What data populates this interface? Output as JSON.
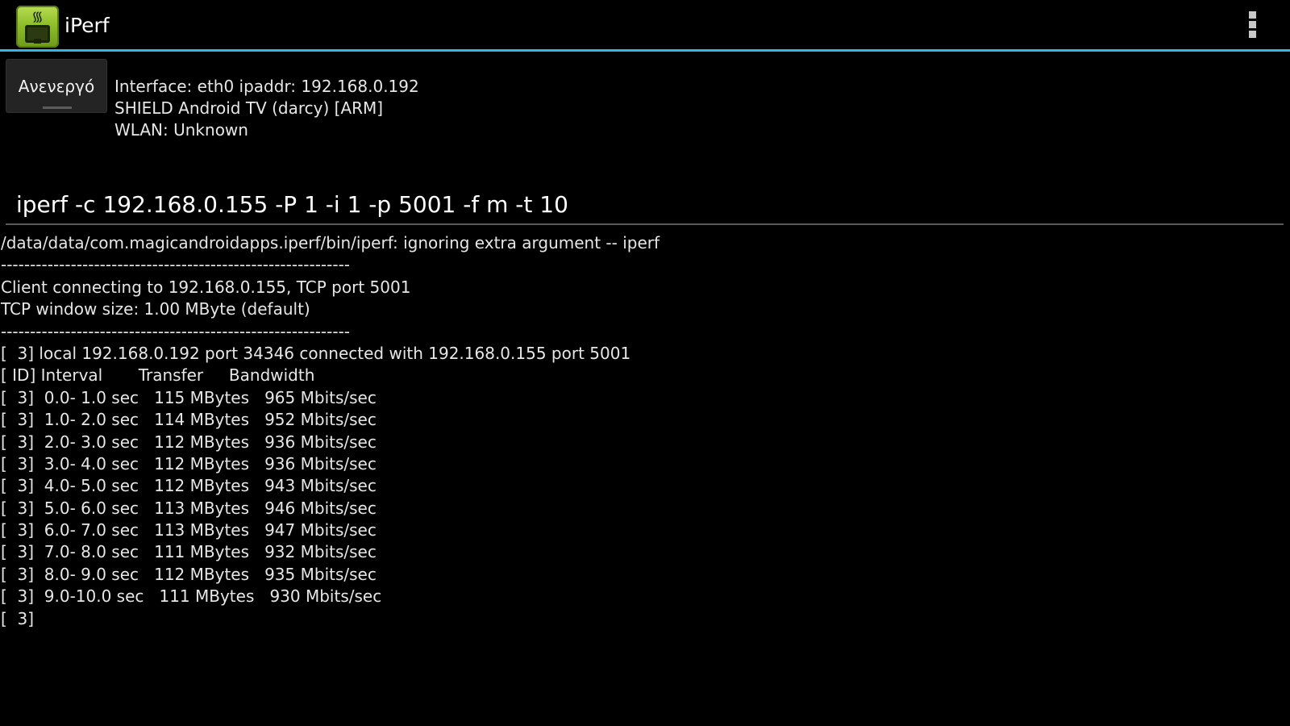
{
  "app": {
    "title": "iPerf",
    "icon": "iperf-app-icon",
    "accent_color": "#33b5e5",
    "background_color": "#000000"
  },
  "toggle": {
    "label": "Ανενεργό"
  },
  "device_info": {
    "interface": "Interface: eth0 ipaddr: 192.168.0.192",
    "device": "SHIELD Android TV (darcy) [ARM]",
    "wlan": "WLAN: Unknown"
  },
  "command": {
    "value": "iperf -c 192.168.0.155 -P 1 -i 1 -p 5001 -f m -t 10"
  },
  "output": {
    "lines": [
      "/data/data/com.magicandroidapps.iperf/bin/iperf: ignoring extra argument -- iperf",
      "------------------------------------------------------------",
      "Client connecting to 192.168.0.155, TCP port 5001",
      "TCP window size: 1.00 MByte (default)",
      "------------------------------------------------------------",
      "[  3] local 192.168.0.192 port 34346 connected with 192.168.0.155 port 5001",
      "[ ID] Interval       Transfer     Bandwidth",
      "[  3]  0.0- 1.0 sec   115 MBytes   965 Mbits/sec",
      "[  3]  1.0- 2.0 sec   114 MBytes   952 Mbits/sec",
      "[  3]  2.0- 3.0 sec   112 MBytes   936 Mbits/sec",
      "[  3]  3.0- 4.0 sec   112 MBytes   936 Mbits/sec",
      "[  3]  4.0- 5.0 sec   112 MBytes   943 Mbits/sec",
      "[  3]  5.0- 6.0 sec   113 MBytes   946 Mbits/sec",
      "[  3]  6.0- 7.0 sec   113 MBytes   947 Mbits/sec",
      "[  3]  7.0- 8.0 sec   111 MBytes   932 Mbits/sec",
      "[  3]  8.0- 9.0 sec   112 MBytes   935 Mbits/sec",
      "[  3]  9.0-10.0 sec   111 MBytes   930 Mbits/sec",
      "[  3]"
    ]
  }
}
